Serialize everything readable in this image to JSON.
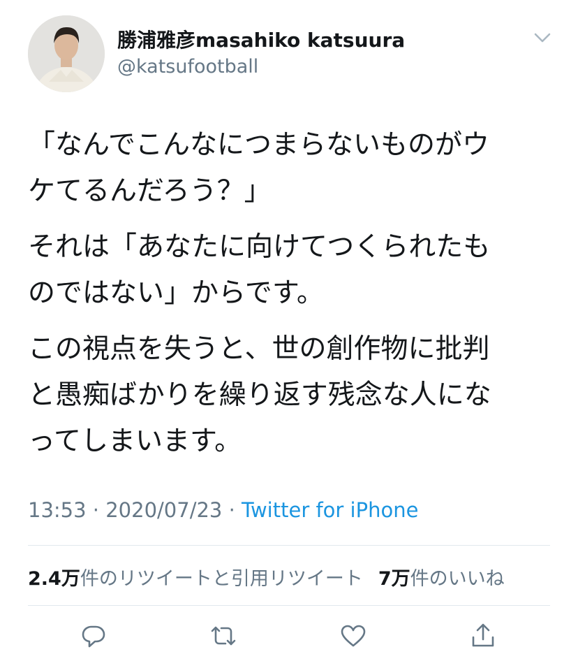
{
  "user": {
    "display_name": "勝浦雅彦masahiko katsuura",
    "handle": "@katsufootball",
    "menu_icon": "chevron-down-icon"
  },
  "tweet": {
    "lines": [
      "「なんでこんなにつまらないものがウ",
      "ケてるんだろう？」",
      "それは「あなたに向けてつくられたも",
      "のではない」からです。",
      "この視点を失うと、世の創作物に批判",
      "と愚痴ばかりを繰り返す残念な人にな",
      "ってしまいます。"
    ]
  },
  "meta": {
    "time": "13:53",
    "separator": " · ",
    "date": "2020/07/23",
    "source": "Twitter for iPhone"
  },
  "stats": {
    "retweets_count": "2.4万",
    "retweets_label": "件のリツイートと引用リツイート",
    "likes_count": "7万",
    "likes_label": "件のいいね"
  },
  "actions": [
    {
      "name": "reply",
      "icon": "reply-icon"
    },
    {
      "name": "retweet",
      "icon": "retweet-icon"
    },
    {
      "name": "like",
      "icon": "heart-icon"
    },
    {
      "name": "share",
      "icon": "share-icon"
    }
  ],
  "colors": {
    "text": "#14171a",
    "secondary": "#657786",
    "link": "#1b95e0",
    "divider": "#e1e8ed"
  }
}
